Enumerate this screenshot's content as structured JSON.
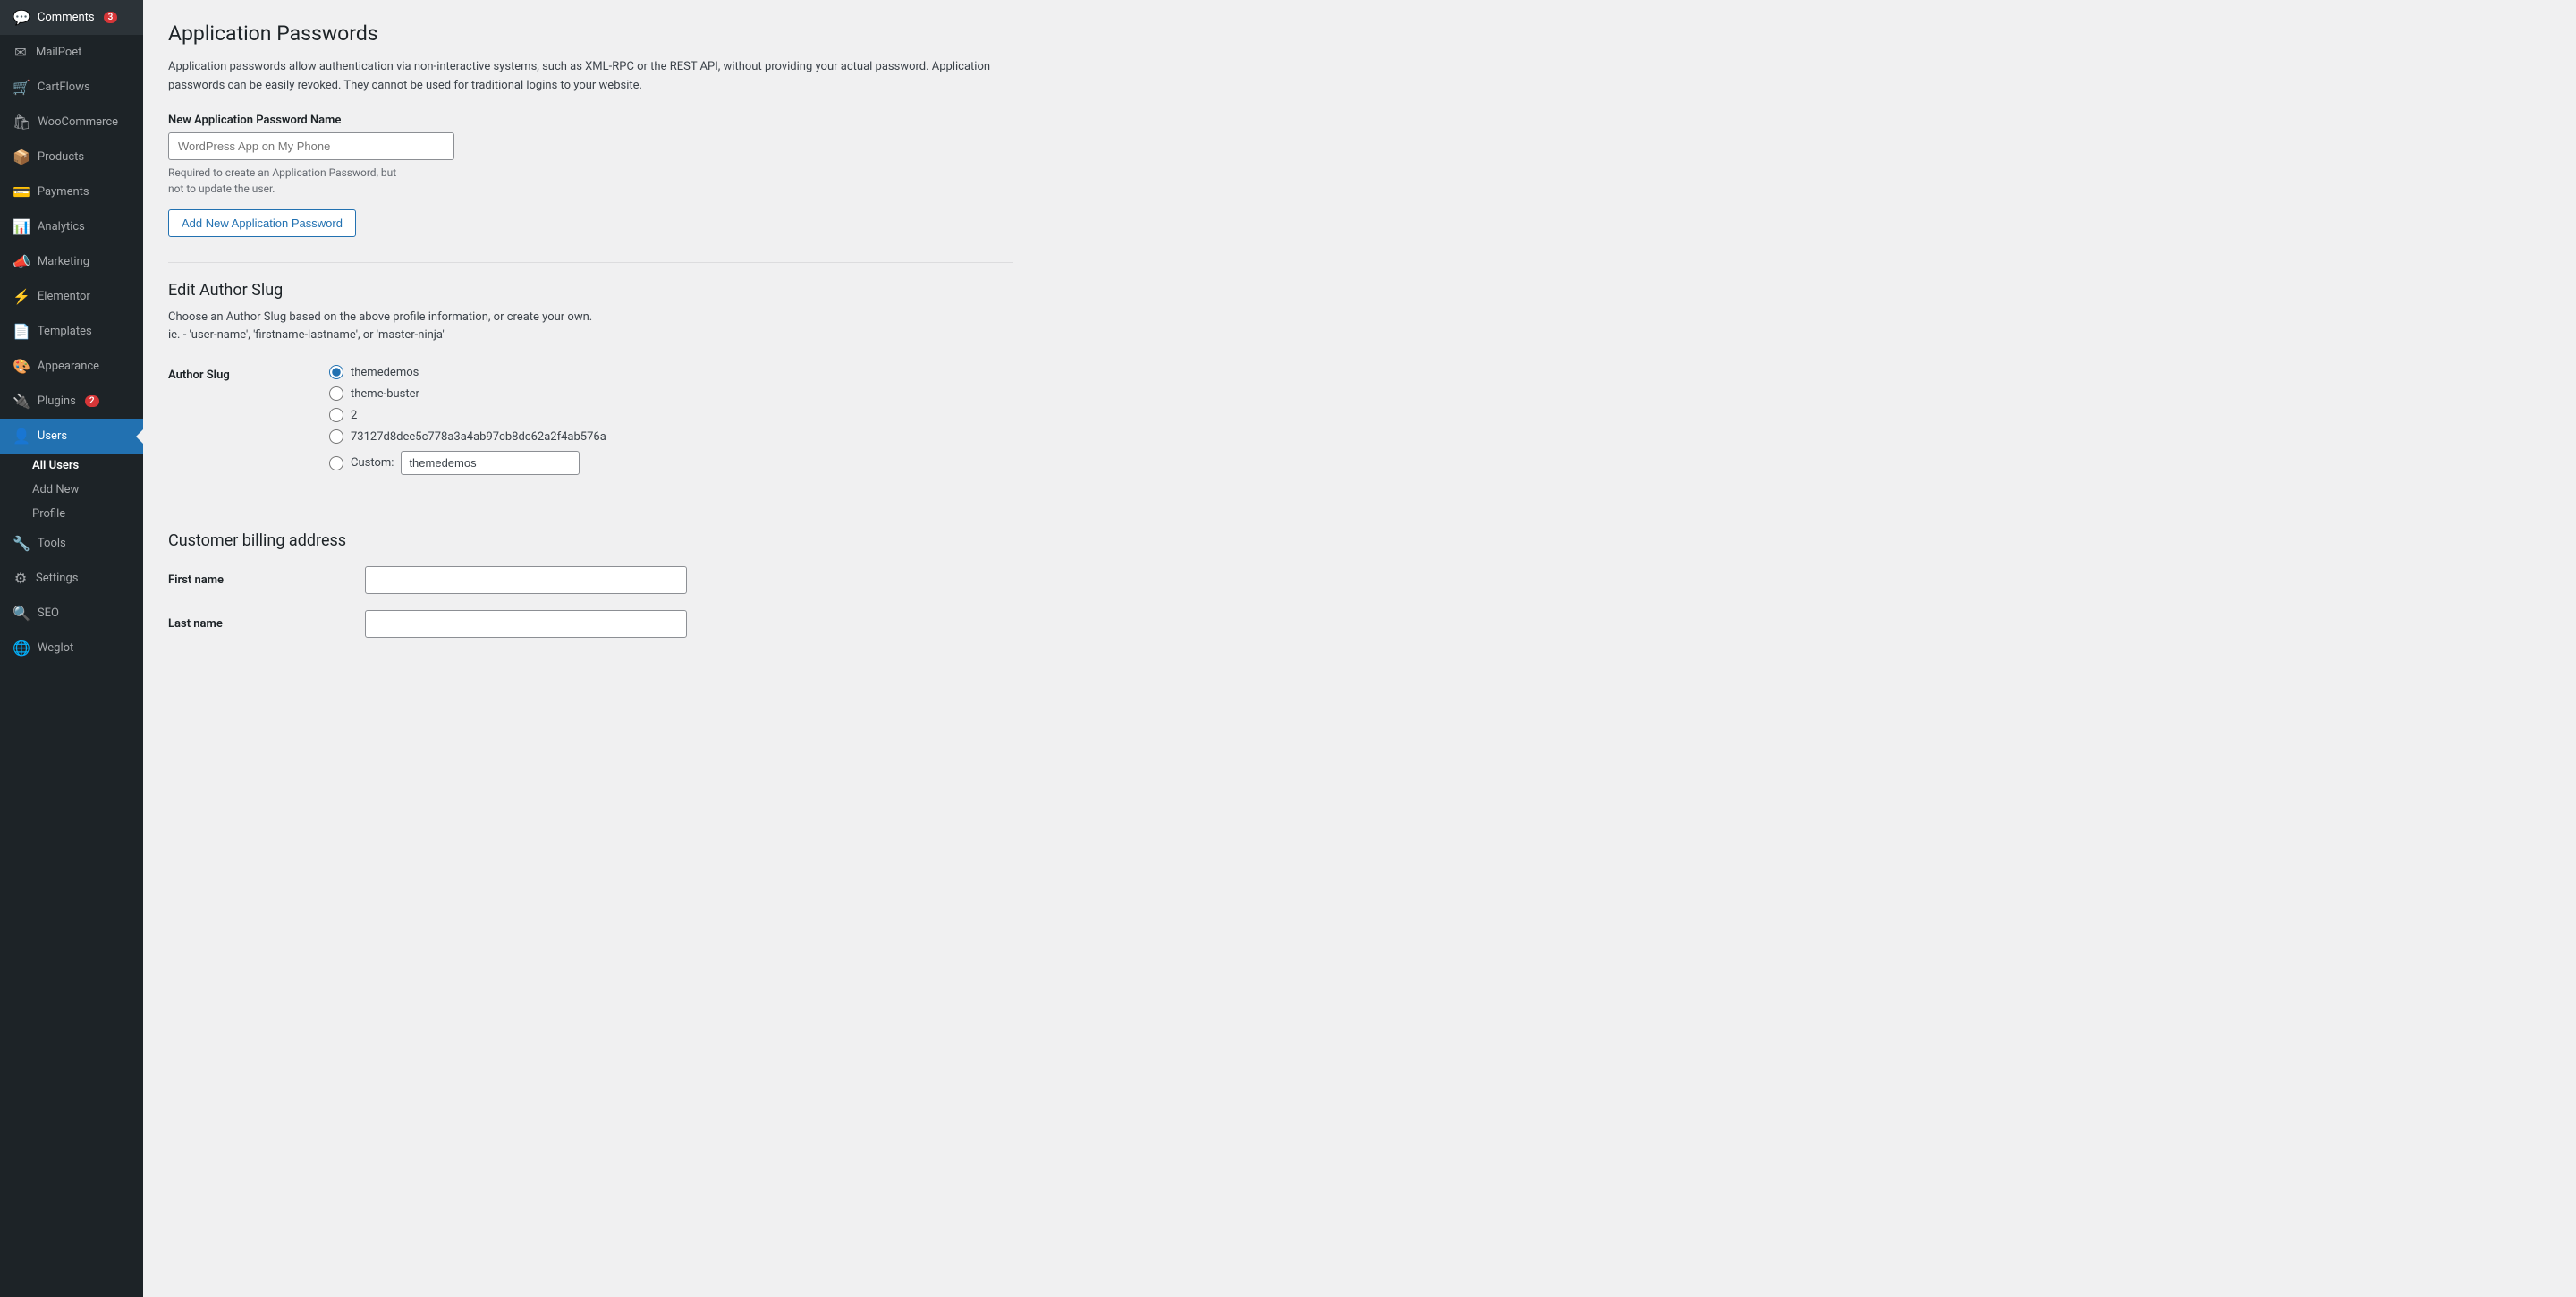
{
  "sidebar": {
    "items": [
      {
        "id": "comments",
        "label": "Comments",
        "icon": "💬",
        "badge": "3"
      },
      {
        "id": "mailpoet",
        "label": "MailPoet",
        "icon": "✉"
      },
      {
        "id": "cartflows",
        "label": "CartFlows",
        "icon": "🛒"
      },
      {
        "id": "woocommerce",
        "label": "WooCommerce",
        "icon": "🛍"
      },
      {
        "id": "products",
        "label": "Products",
        "icon": "📦"
      },
      {
        "id": "payments",
        "label": "Payments",
        "icon": "💳"
      },
      {
        "id": "analytics",
        "label": "Analytics",
        "icon": "📊"
      },
      {
        "id": "marketing",
        "label": "Marketing",
        "icon": "📣"
      },
      {
        "id": "elementor",
        "label": "Elementor",
        "icon": "⚡"
      },
      {
        "id": "templates",
        "label": "Templates",
        "icon": "📄"
      },
      {
        "id": "appearance",
        "label": "Appearance",
        "icon": "🎨"
      },
      {
        "id": "plugins",
        "label": "Plugins",
        "icon": "🔌",
        "badge": "2"
      },
      {
        "id": "users",
        "label": "Users",
        "icon": "👤",
        "active": true
      },
      {
        "id": "tools",
        "label": "Tools",
        "icon": "🔧"
      },
      {
        "id": "settings",
        "label": "Settings",
        "icon": "⚙"
      },
      {
        "id": "seo",
        "label": "SEO",
        "icon": "🔍"
      },
      {
        "id": "weglot",
        "label": "Weglot",
        "icon": "🌐"
      }
    ],
    "sub_items": [
      {
        "id": "all-users",
        "label": "All Users",
        "active": true
      },
      {
        "id": "add-new",
        "label": "Add New"
      },
      {
        "id": "profile",
        "label": "Profile"
      }
    ]
  },
  "main": {
    "page_title": "Application Passwords",
    "description": "Application passwords allow authentication via non-interactive systems, such as XML-RPC or the REST API, without providing your actual password. Application passwords can be easily revoked. They cannot be used for traditional logins to your website.",
    "new_password_label": "New Application Password Name",
    "new_password_placeholder": "WordPress App on My Phone",
    "new_password_hint_line1": "Required to create an Application Password, but",
    "new_password_hint_line2": "not to update the user.",
    "add_password_button": "Add New Application Password",
    "edit_slug_title": "Edit Author Slug",
    "edit_slug_description_line1": "Choose an Author Slug based on the above profile information, or create your own.",
    "edit_slug_description_line2": "ie. - 'user-name', 'firstname-lastname', or 'master-ninja'",
    "author_slug_label": "Author Slug",
    "slug_options": [
      {
        "id": "slug-themedemos",
        "value": "themedemos",
        "label": "themedemos",
        "checked": true
      },
      {
        "id": "slug-theme-buster",
        "value": "theme-buster",
        "label": "theme-buster",
        "checked": false
      },
      {
        "id": "slug-2",
        "value": "2",
        "label": "2",
        "checked": false
      },
      {
        "id": "slug-hash",
        "value": "73127d8dee5c778a3a4ab97cb8dc62a2f4ab576a",
        "label": "73127d8dee5c778a3a4ab97cb8dc62a2f4ab576a",
        "checked": false
      },
      {
        "id": "slug-custom",
        "value": "custom",
        "label": "Custom:",
        "checked": false
      }
    ],
    "custom_slug_value": "themedemos",
    "billing_title": "Customer billing address",
    "billing_fields": [
      {
        "id": "first-name",
        "label": "First name",
        "value": ""
      },
      {
        "id": "last-name",
        "label": "Last name",
        "value": ""
      }
    ]
  }
}
